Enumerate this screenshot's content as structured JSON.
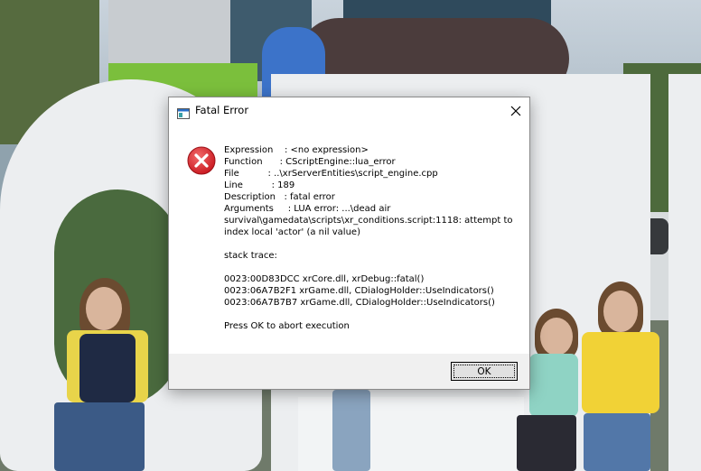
{
  "dialog": {
    "title": "Fatal Error",
    "close_icon": "close-icon",
    "app_icon": "window-icon",
    "error_icon": "error-x-icon",
    "message": "Expression    : <no expression>\nFunction      : CScriptEngine::lua_error\nFile          : ..\\xrServerEntities\\script_engine.cpp\nLine          : 189\nDescription   : fatal error\nArguments     : LUA error: ...\\dead air survival\\gamedata\\scripts\\xr_conditions.script:1118: attempt to index local 'actor' (a nil value)\n\nstack trace:\n\n0023:00D83DCC xrCore.dll, xrDebug::fatal()\n0023:06A7B2F1 xrGame.dll, CDialogHolder::UseIndicators()\n0023:06A7B7B7 xrGame.dll, CDialogHolder::UseIndicators()\n\nPress OK to abort execution",
    "ok_label": "OK"
  },
  "colors": {
    "error_red": "#d9262c",
    "footer_bg": "#f0f0f0",
    "button_bg": "#e1e1e1"
  }
}
